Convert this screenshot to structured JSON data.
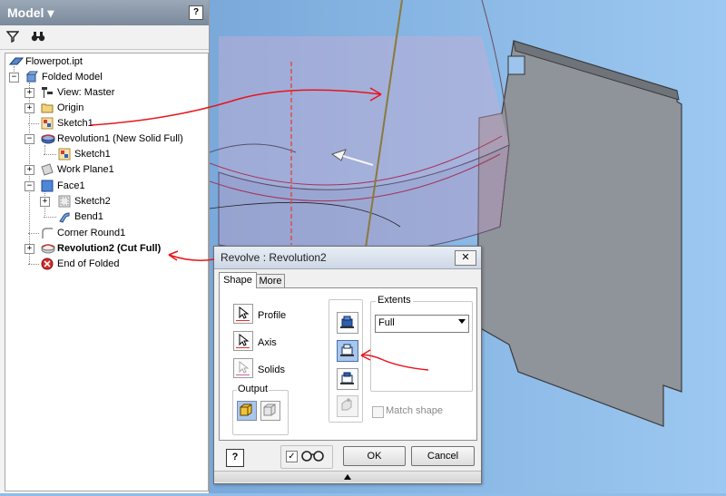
{
  "browser": {
    "title": "Model",
    "help_label": "?",
    "toolbar": [
      {
        "icon": "filter-icon",
        "glyph": "⛉"
      },
      {
        "icon": "find-icon",
        "glyph": "⚯"
      }
    ],
    "tree": {
      "root": "Flowerpot.ipt",
      "folded": "Folded Model",
      "view": "View: Master",
      "origin": "Origin",
      "sketch1": "Sketch1",
      "revolution1": "Revolution1 (New Solid Full)",
      "rev1_sketch": "Sketch1",
      "workplane": "Work Plane1",
      "face1": "Face1",
      "sketch2": "Sketch2",
      "bend1": "Bend1",
      "corner": "Corner Round1",
      "revolution2": "Revolution2 (Cut Full)",
      "end": "End of Folded"
    }
  },
  "dialog": {
    "title": "Revolve : Revolution2",
    "close": "✕",
    "tabs": [
      "Shape",
      "More"
    ],
    "profile": "Profile",
    "axis": "Axis",
    "solids": "Solids",
    "output": "Output",
    "extents": "Extents",
    "extents_value": "Full",
    "match_shape": "Match shape",
    "preview_check": "✓",
    "ok": "OK",
    "cancel": "Cancel",
    "help": "?"
  },
  "colors": {
    "annotation": "#e8141c",
    "viewport": "#8fbde8",
    "part": "#8b8f96"
  }
}
